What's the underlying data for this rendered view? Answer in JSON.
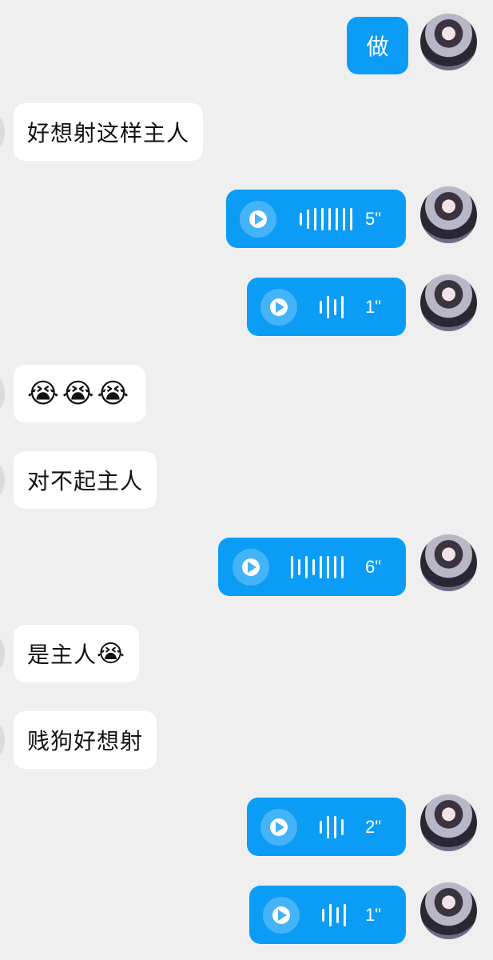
{
  "messages": [
    {
      "side": "out",
      "type": "text",
      "text": "做"
    },
    {
      "side": "in",
      "type": "text",
      "text": "好想射这样主人"
    },
    {
      "side": "out",
      "type": "voice",
      "duration": "5\""
    },
    {
      "side": "out",
      "type": "voice",
      "duration": "1\""
    },
    {
      "side": "in",
      "type": "emoji",
      "emoji": "😭😭😭"
    },
    {
      "side": "in",
      "type": "text",
      "text": "对不起主人"
    },
    {
      "side": "out",
      "type": "voice",
      "duration": "6\""
    },
    {
      "side": "in",
      "type": "text",
      "text": "是主人",
      "emoji": "😭"
    },
    {
      "side": "in",
      "type": "text",
      "text": "贱狗好想射"
    },
    {
      "side": "out",
      "type": "voice",
      "duration": "2\""
    },
    {
      "side": "out",
      "type": "voice",
      "duration": "1\""
    }
  ],
  "colors": {
    "bubble_out": "#0b9df6",
    "bubble_in": "#ffffff",
    "background": "#efeff0"
  },
  "icons": {
    "play": "play-icon",
    "waveform": "waveform-icon",
    "avatar": "avatar"
  }
}
